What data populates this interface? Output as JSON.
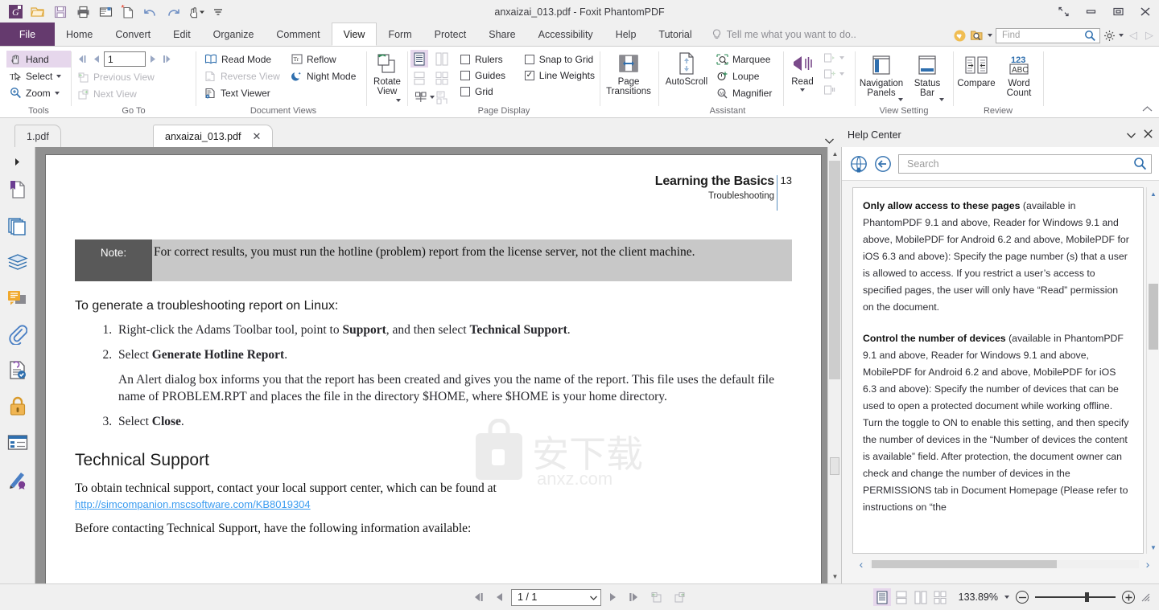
{
  "window": {
    "title": "anxaizai_013.pdf - Foxit PhantomPDF",
    "quick_access": [
      {
        "name": "foxit-logo-icon",
        "label": "Foxit"
      },
      {
        "name": "open-icon",
        "label": "Open"
      },
      {
        "name": "save-icon",
        "label": "Save"
      },
      {
        "name": "print-icon",
        "label": "Print"
      },
      {
        "name": "email-icon",
        "label": "Email"
      },
      {
        "name": "new-from-template-icon",
        "label": "Create PDF"
      },
      {
        "name": "undo-icon",
        "label": "Undo"
      },
      {
        "name": "redo-icon",
        "label": "Redo"
      },
      {
        "name": "touch-mode-icon",
        "label": "Touch Mode"
      },
      {
        "name": "customize-qat-icon",
        "label": "Customize"
      }
    ],
    "controls": [
      {
        "name": "restore-down-icon",
        "label": "Restore"
      },
      {
        "name": "minimize-icon",
        "label": "Minimize"
      },
      {
        "name": "maximize-icon",
        "label": "Maximize"
      },
      {
        "name": "close-icon",
        "label": "Close"
      }
    ]
  },
  "menu": {
    "file_label": "File",
    "tabs": [
      {
        "label": "Home",
        "active": false
      },
      {
        "label": "Convert",
        "active": false
      },
      {
        "label": "Edit",
        "active": false
      },
      {
        "label": "Organize",
        "active": false
      },
      {
        "label": "Comment",
        "active": false
      },
      {
        "label": "View",
        "active": true
      },
      {
        "label": "Form",
        "active": false
      },
      {
        "label": "Protect",
        "active": false
      },
      {
        "label": "Share",
        "active": false
      },
      {
        "label": "Accessibility",
        "active": false
      },
      {
        "label": "Help",
        "active": false
      },
      {
        "label": "Tutorial",
        "active": false
      }
    ],
    "tell_me": "Tell me what you want to do..",
    "find_placeholder": "Find"
  },
  "ribbon": {
    "groups": [
      {
        "name": "tools",
        "label": "Tools",
        "items": [
          {
            "label": "Hand",
            "icon": "hand-icon",
            "state": "selected"
          },
          {
            "label": "Select",
            "icon": "select-text-icon",
            "dropdown": true
          },
          {
            "label": "Zoom",
            "icon": "zoom-icon",
            "dropdown": true
          }
        ]
      },
      {
        "name": "go-to",
        "label": "Go To",
        "page_number": "1",
        "items": [
          {
            "label": "Previous View",
            "icon": "previous-view-icon",
            "state": "disabled"
          },
          {
            "label": "Next View",
            "icon": "next-view-icon",
            "state": "disabled"
          }
        ]
      },
      {
        "name": "document-views",
        "label": "Document Views",
        "items": [
          {
            "label": "Read Mode",
            "icon": "read-mode-icon"
          },
          {
            "label": "Reverse View",
            "icon": "reverse-view-icon",
            "state": "disabled"
          },
          {
            "label": "Text Viewer",
            "icon": "text-viewer-icon"
          },
          {
            "label": "Reflow",
            "icon": "reflow-icon"
          },
          {
            "label": "Night Mode",
            "icon": "night-mode-icon"
          }
        ]
      },
      {
        "name": "rotate-view",
        "label": "",
        "items": [
          {
            "label": "Rotate View",
            "icon": "rotate-view-icon",
            "dropdown": true
          }
        ]
      },
      {
        "name": "page-display",
        "label": "Page Display",
        "layout_buttons": [
          {
            "name": "single-page-icon",
            "state": "selected"
          },
          {
            "name": "facing-pages-icon",
            "state": "disabled"
          },
          {
            "name": "continuous-icon",
            "state": "disabled"
          },
          {
            "name": "continuous-facing-icon",
            "state": "disabled"
          },
          {
            "name": "split-view-icon",
            "dropdown": true
          },
          {
            "name": "separate-cover-icon",
            "state": "disabled"
          }
        ],
        "checkboxes": [
          {
            "label": "Rulers",
            "checked": false
          },
          {
            "label": "Guides",
            "checked": false
          },
          {
            "label": "Grid",
            "checked": false
          },
          {
            "label": "Snap to Grid",
            "checked": false
          },
          {
            "label": "Line Weights",
            "checked": true
          }
        ]
      },
      {
        "name": "page-transitions",
        "label": "",
        "items": [
          {
            "label": "Page\nTransitions",
            "icon": "page-transitions-icon"
          }
        ]
      },
      {
        "name": "assistant",
        "label": "Assistant",
        "autoscroll_label": "AutoScroll",
        "items": [
          {
            "label": "Marquee",
            "icon": "marquee-zoom-icon"
          },
          {
            "label": "Loupe",
            "icon": "loupe-icon"
          },
          {
            "label": "Magnifier",
            "icon": "magnifier-icon"
          }
        ],
        "read_label": "Read",
        "read_subbuttons": [
          {
            "name": "read-current-page-icon",
            "state": "disabled"
          },
          {
            "name": "read-from-page-icon",
            "state": "disabled"
          },
          {
            "name": "read-pause-icon",
            "state": "disabled"
          }
        ]
      },
      {
        "name": "view-setting",
        "label": "View Setting",
        "items": [
          {
            "label": "Navigation\nPanels",
            "icon": "navigation-panels-icon",
            "dropdown": true
          },
          {
            "label": "Status\nBar",
            "icon": "status-bar-icon",
            "dropdown": true
          }
        ]
      },
      {
        "name": "review",
        "label": "Review",
        "items": [
          {
            "label": "Compare",
            "icon": "compare-icon"
          },
          {
            "label": "Word\nCount",
            "icon": "word-count-icon"
          }
        ]
      }
    ]
  },
  "doc_tabs": [
    {
      "label": "1.pdf",
      "active": false,
      "closable": false
    },
    {
      "label": "anxaizai_013.pdf",
      "active": true,
      "closable": true
    }
  ],
  "help_panel": {
    "title": "Help Center",
    "search_placeholder": "Search",
    "home_icon": "help-home-icon",
    "back_icon": "help-back-icon",
    "paragraphs": [
      {
        "bold": "Only allow access to these pages",
        "text": " (available in PhantomPDF 9.1 and above, Reader for Windows 9.1 and above, MobilePDF for Android 6.2 and above, MobilePDF for iOS 6.3 and above): Specify the page number (s) that a user is allowed to access. If you restrict a user’s access to specified pages, the user will only have “Read” permission on the document."
      },
      {
        "bold": "Control the number of devices",
        "text": " (available in PhantomPDF 9.1 and above, Reader for Windows 9.1 and above, MobilePDF for Android 6.2 and above, MobilePDF for iOS 6.3 and above): Specify the number of devices that can be used to open a protected document while working offline. Turn the toggle to ON to enable this setting, and then specify the number of devices in the “Number of devices the content is available” field. After protection, the document owner can check and change the number of devices in the PERMISSIONS tab in Document Homepage (Please refer to instructions on “the"
      }
    ]
  },
  "nav_rail": [
    {
      "name": "bookmarks-icon",
      "label": "Bookmarks"
    },
    {
      "name": "page-thumbnails-icon",
      "label": "Page Thumbnails"
    },
    {
      "name": "layers-icon",
      "label": "Layers"
    },
    {
      "name": "comments-icon",
      "label": "Comments"
    },
    {
      "name": "attachments-icon",
      "label": "Attachments"
    },
    {
      "name": "stamps-icon",
      "label": "Stamps"
    },
    {
      "name": "security-icon",
      "label": "Security"
    },
    {
      "name": "fields-icon",
      "label": "Fields"
    },
    {
      "name": "signatures-icon",
      "label": "Digital Signatures"
    }
  ],
  "document": {
    "header_title": "Learning the Basics",
    "header_subtitle": "Troubleshooting",
    "page_number": "13",
    "note_label": "Note:",
    "note_text": "For correct results, you must run the hotline (problem) report from the license server, not the client machine.",
    "lead_in": "To generate a troubleshooting report on Linux:",
    "steps": [
      {
        "parts": [
          {
            "t": "Right-click the Adams Toolbar tool, point to ",
            "b": false
          },
          {
            "t": "Support",
            "b": true
          },
          {
            "t": ", and then select ",
            "b": false
          },
          {
            "t": "Technical Support",
            "b": true
          },
          {
            "t": ".",
            "b": false
          }
        ],
        "sub": ""
      },
      {
        "parts": [
          {
            "t": "Select ",
            "b": false
          },
          {
            "t": "Generate Hotline Report",
            "b": true
          },
          {
            "t": ".",
            "b": false
          }
        ],
        "sub": "An Alert dialog box informs you that the report has been created and gives you the name of the report. This file uses the default file name of PROBLEM.RPT and places the file in the directory $HOME, where $HOME is your home directory."
      },
      {
        "parts": [
          {
            "t": "Select ",
            "b": false
          },
          {
            "t": "Close",
            "b": true
          },
          {
            "t": ".",
            "b": false
          }
        ],
        "sub": ""
      }
    ],
    "section_heading": "Technical Support",
    "para1": "To obtain technical support, contact your local support center, which can be found at",
    "link": "http://simcompanion.mscsoftware.com/KB8019304",
    "para2": "Before contacting Technical Support, have the following information available:",
    "watermark_text": "anxz.com"
  },
  "statusbar": {
    "page_indicator": "1 / 1",
    "zoom_level": "133.89%",
    "nav_buttons": [
      {
        "name": "first-page-button",
        "label": "First Page"
      },
      {
        "name": "previous-page-button",
        "label": "Previous Page"
      },
      {
        "name": "next-page-button",
        "label": "Next Page"
      },
      {
        "name": "last-page-button",
        "label": "Last Page"
      },
      {
        "name": "previous-view-button",
        "label": "Previous View"
      },
      {
        "name": "next-view-button",
        "label": "Next View"
      }
    ],
    "view_modes": [
      {
        "name": "single-page-view-button",
        "selected": true
      },
      {
        "name": "continuous-view-button",
        "selected": false
      },
      {
        "name": "facing-view-button",
        "selected": false
      },
      {
        "name": "continuous-facing-view-button",
        "selected": false
      }
    ],
    "zoom_out_label": "−",
    "zoom_in_label": "+"
  },
  "colors": {
    "accent_purple": "#653a6e",
    "selection_purple": "#e6d7ec",
    "link_blue": "#3b9cf0",
    "doc_bg_gray": "#909090",
    "note_label_gray": "#595959",
    "note_body_gray": "#c8c8c8"
  }
}
